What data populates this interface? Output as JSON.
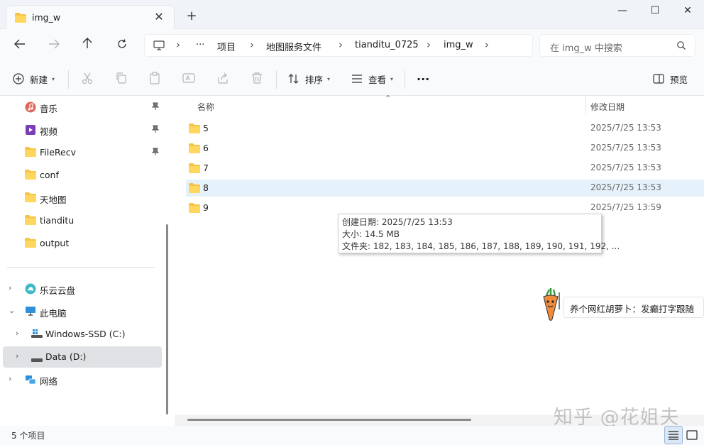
{
  "window": {
    "tab_title": "img_w",
    "tab_close": "✕",
    "new_tab": "+",
    "minimize": "—",
    "maximize": "☐",
    "close": "✕"
  },
  "address": {
    "more": "···",
    "crumbs": [
      "项目",
      "地图服务文件",
      "tianditu_0725",
      "img_w"
    ],
    "search_placeholder": "在 img_w 中搜索"
  },
  "toolbar": {
    "new_label": "新建",
    "sort_label": "排序",
    "view_label": "查看",
    "more_label": "···",
    "preview_label": "预览"
  },
  "sidebar": {
    "quick": [
      {
        "label": "音乐",
        "icon": "music-icon",
        "pinned": true
      },
      {
        "label": "视频",
        "icon": "video-icon",
        "pinned": true
      },
      {
        "label": "FileRecv",
        "icon": "folder-icon",
        "pinned": true
      },
      {
        "label": "conf",
        "icon": "folder-icon",
        "pinned": false
      },
      {
        "label": "天地图",
        "icon": "folder-icon",
        "pinned": false
      },
      {
        "label": "tianditu",
        "icon": "folder-icon",
        "pinned": false
      },
      {
        "label": "output",
        "icon": "folder-icon",
        "pinned": false
      }
    ],
    "tree": [
      {
        "label": "乐云云盘",
        "icon": "cloud-icon"
      },
      {
        "label": "此电脑",
        "icon": "computer-icon"
      },
      {
        "label": "Windows-SSD (C:)",
        "icon": "windows-drive-icon"
      },
      {
        "label": "Data (D:)",
        "icon": "drive-icon",
        "selected": true
      },
      {
        "label": "网络",
        "icon": "network-icon"
      }
    ]
  },
  "columns": {
    "name": "名称",
    "date": "修改日期"
  },
  "rows": [
    {
      "name": "5",
      "date": "2025/7/25 13:53"
    },
    {
      "name": "6",
      "date": "2025/7/25 13:53"
    },
    {
      "name": "7",
      "date": "2025/7/25 13:53"
    },
    {
      "name": "8",
      "date": "2025/7/25 13:53",
      "hover": true
    },
    {
      "name": "9",
      "date": "2025/7/25 13:59"
    }
  ],
  "tooltip": {
    "created": "创建日期: 2025/7/25 13:53",
    "size": "大小: 14.5 MB",
    "folders": "文件夹: 182, 183, 184, 185, 186, 187, 188, 189, 190, 191, 192, ..."
  },
  "status": {
    "count": "5 个项目"
  },
  "notification": {
    "text": "养个网红胡萝卜：发癫打字跟随"
  },
  "watermark": {
    "text": "知乎 @花姐夫"
  },
  "colors": {
    "folder": "#f6c445",
    "accent": "#0067c0",
    "hover_row": "#e5f1fb",
    "selected_side": "#dfe1e4"
  }
}
